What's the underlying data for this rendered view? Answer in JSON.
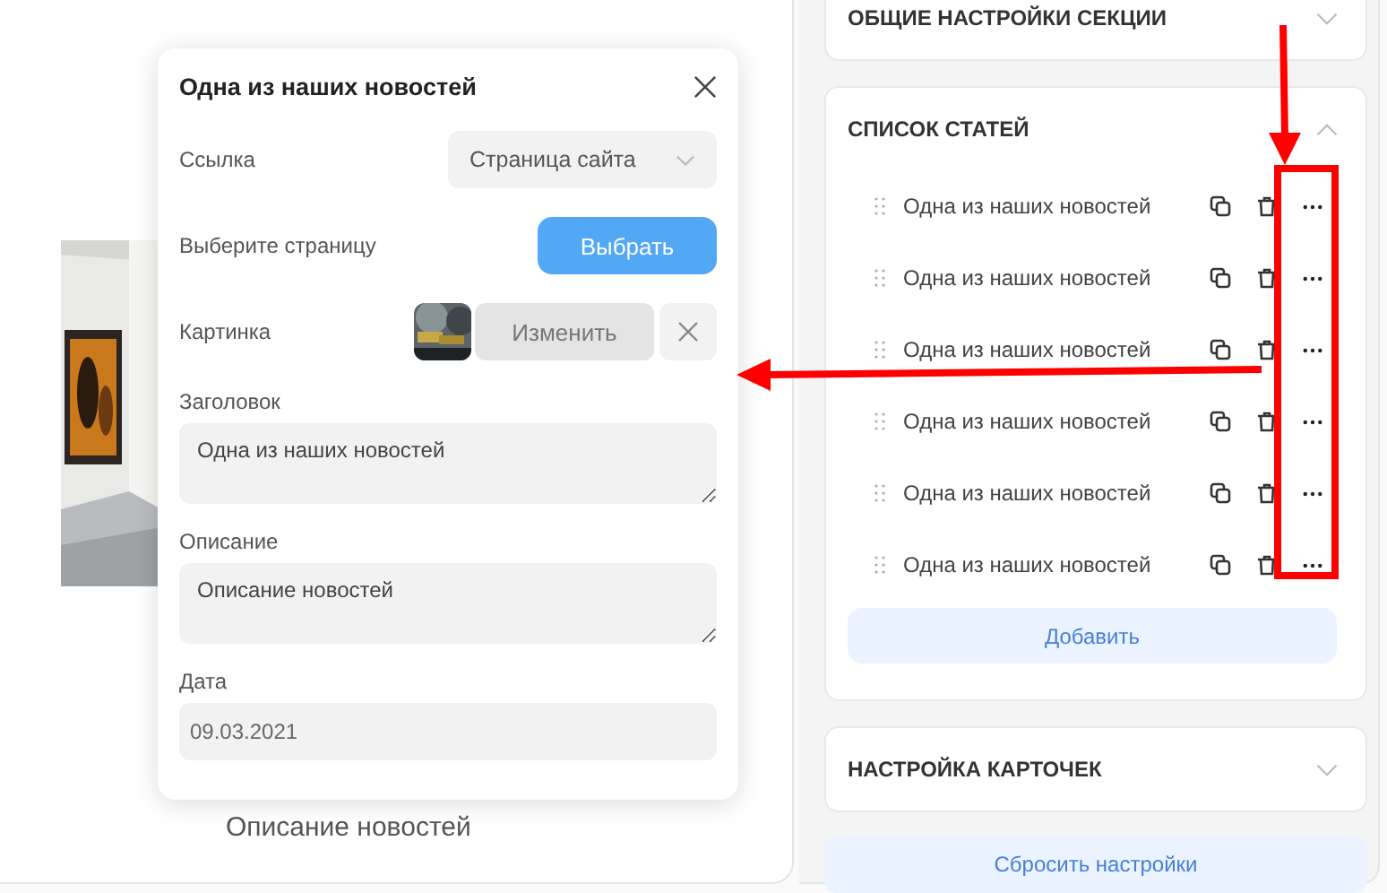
{
  "preview": {
    "description": "Описание новостей"
  },
  "modal": {
    "title": "Одна из наших новостей",
    "link": {
      "label": "Ссылка",
      "value": "Страница сайта"
    },
    "page": {
      "label": "Выберите страницу",
      "button": "Выбрать"
    },
    "image": {
      "label": "Картинка",
      "change_button": "Изменить"
    },
    "heading": {
      "label": "Заголовок",
      "value": "Одна из наших новостей"
    },
    "description": {
      "label": "Описание",
      "value": "Описание новостей"
    },
    "date": {
      "label": "Дата",
      "value": "09.03.2021"
    }
  },
  "sections": [
    {
      "title": "ОБЩИЕ НАСТРОЙКИ СЕКЦИИ",
      "expanded": false
    },
    {
      "title": "СПИСОК СТАТЕЙ",
      "expanded": true,
      "items": [
        {
          "title": "Одна из наших новостей"
        },
        {
          "title": "Одна из наших новостей"
        },
        {
          "title": "Одна из наших новостей"
        },
        {
          "title": "Одна из наших новостей"
        },
        {
          "title": "Одна из наших новостей"
        },
        {
          "title": "Одна из наших новостей"
        }
      ],
      "add_button": "Добавить"
    },
    {
      "title": "НАСТРОЙКА КАРТОЧЕК",
      "expanded": false
    }
  ],
  "reset_button": "Сбросить настройки"
}
